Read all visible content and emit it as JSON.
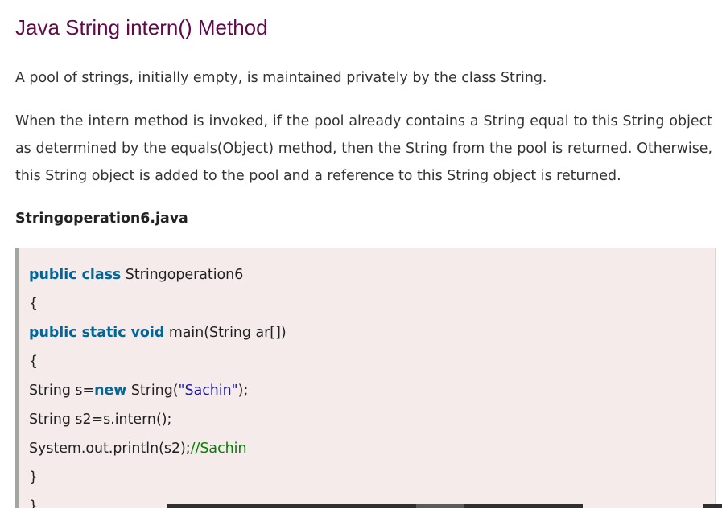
{
  "article": {
    "title": "Java String intern() Method",
    "paragraph_1": "A pool of strings, initially empty, is maintained privately by the class String.",
    "paragraph_2": "When the intern method is invoked, if the pool already contains a String equal to this String object as determined by the equals(Object) method, then the String from the pool is returned. Otherwise, this String object is added to the pool and a reference to this String object is returned.",
    "filename": "Stringoperation6.java"
  },
  "code": {
    "line1_kw": "public class",
    "line1_rest": " Stringoperation6",
    "line2": "{",
    "line3_kw": "public static void",
    "line3_rest": " main(String ar[])",
    "line4": "{",
    "line5_pre": "String s=",
    "line5_kw": "new",
    "line5_mid": " String(",
    "line5_str": "\"Sachin\"",
    "line5_post": ");",
    "line6": "String s2=s.intern();",
    "line7_pre": "System.out.println(s2);",
    "line7_comment": "//Sachin",
    "line8": "}",
    "line9": "}"
  },
  "colors": {
    "title": "#610b4b",
    "keyword": "#006699",
    "string": "#1a1aa6",
    "comment": "#008200",
    "code_background": "#f4ebea",
    "code_border": "#a0a7a0"
  }
}
